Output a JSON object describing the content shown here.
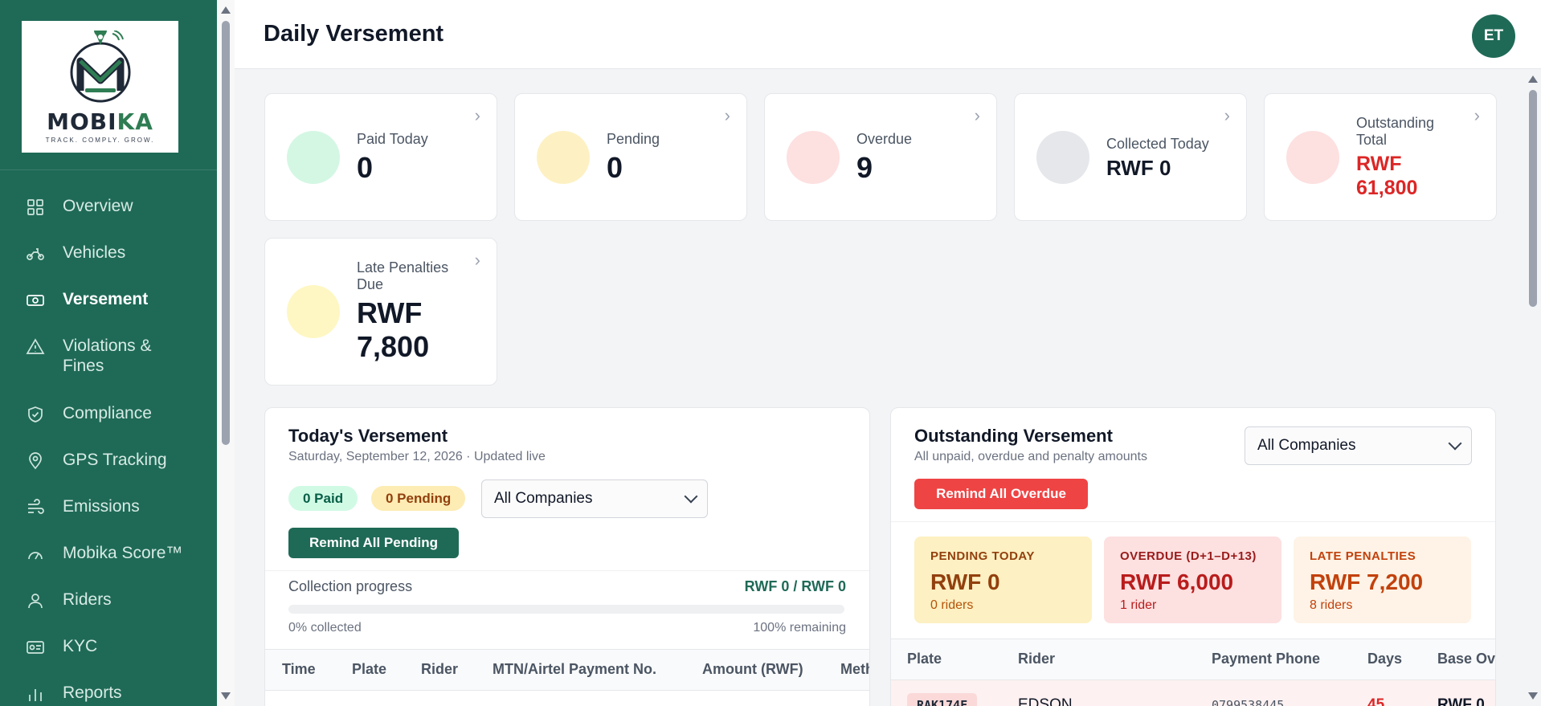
{
  "brand": {
    "name_part1": "MOBI",
    "name_part2": "KA",
    "tagline": "TRACK. COMPLY. GROW.",
    "colors": {
      "primary": "#1f6a57",
      "danger": "#ef4444"
    }
  },
  "sidebar": {
    "items": [
      {
        "label": "Overview",
        "icon": "grid-icon"
      },
      {
        "label": "Vehicles",
        "icon": "motorbike-icon"
      },
      {
        "label": "Versement",
        "icon": "cash-icon",
        "active": true
      },
      {
        "label": "Violations & Fines",
        "icon": "warning-icon"
      },
      {
        "label": "Compliance",
        "icon": "shield-check-icon"
      },
      {
        "label": "GPS Tracking",
        "icon": "map-pin-icon"
      },
      {
        "label": "Emissions",
        "icon": "emissions-icon"
      },
      {
        "label": "Mobika Score™",
        "icon": "gauge-icon"
      },
      {
        "label": "Riders",
        "icon": "user-icon"
      },
      {
        "label": "KYC",
        "icon": "id-card-icon"
      },
      {
        "label": "Reports",
        "icon": "bar-chart-icon"
      }
    ]
  },
  "header": {
    "title": "Daily Versement",
    "avatar": "ET"
  },
  "stats": [
    {
      "label": "Paid Today",
      "value": "0",
      "circle": "#d4f7e4",
      "value_color": "#111827"
    },
    {
      "label": "Pending",
      "value": "0",
      "circle": "#fdf1c4",
      "value_color": "#111827"
    },
    {
      "label": "Overdue",
      "value": "9",
      "circle": "#fde0e0",
      "value_color": "#111827"
    },
    {
      "label": "Collected Today",
      "value": "RWF 0",
      "circle": "#e5e7eb",
      "value_color": "#111827"
    },
    {
      "label": "Outstanding Total",
      "value": "RWF 61,800",
      "circle": "#fde0e0",
      "value_color": "#dc2626"
    },
    {
      "label": "Late Penalties Due",
      "value": "RWF 7,800",
      "circle": "#fef7c3",
      "value_color": "#111827"
    }
  ],
  "today": {
    "title": "Today's Versement",
    "subtitle": "Saturday, September 12, 2026 · Updated live",
    "paid_pill": "0 Paid",
    "pending_pill": "0 Pending",
    "company_filter": "All Companies",
    "remind_button": "Remind All Pending",
    "progress_label": "Collection progress",
    "progress_amount": "RWF 0 / RWF 0",
    "progress_fraction": 0,
    "collected_text": "0% collected",
    "remaining_text": "100% remaining",
    "columns": [
      "Time",
      "Plate",
      "Rider",
      "MTN/Airtel Payment No.",
      "Amount (RWF)",
      "Method"
    ]
  },
  "outstanding": {
    "title": "Outstanding Versement",
    "subtitle": "All unpaid, overdue and penalty amounts",
    "company_filter": "All Companies",
    "remind_button": "Remind All Overdue",
    "summaries": [
      {
        "label": "PENDING TODAY",
        "value": "RWF 0",
        "sub": "0 riders"
      },
      {
        "label": "OVERDUE (D+1–D+13)",
        "value": "RWF 6,000",
        "sub": "1 rider"
      },
      {
        "label": "LATE PENALTIES",
        "value": "RWF 7,200",
        "sub": "8 riders"
      }
    ],
    "columns": [
      "Plate",
      "Rider",
      "Payment Phone",
      "Days",
      "Base Ov"
    ],
    "rows": [
      {
        "plate": "RAK174F",
        "rider": "EDSON",
        "phone": "0799538445",
        "days": "45",
        "base": "RWF 0"
      }
    ]
  }
}
